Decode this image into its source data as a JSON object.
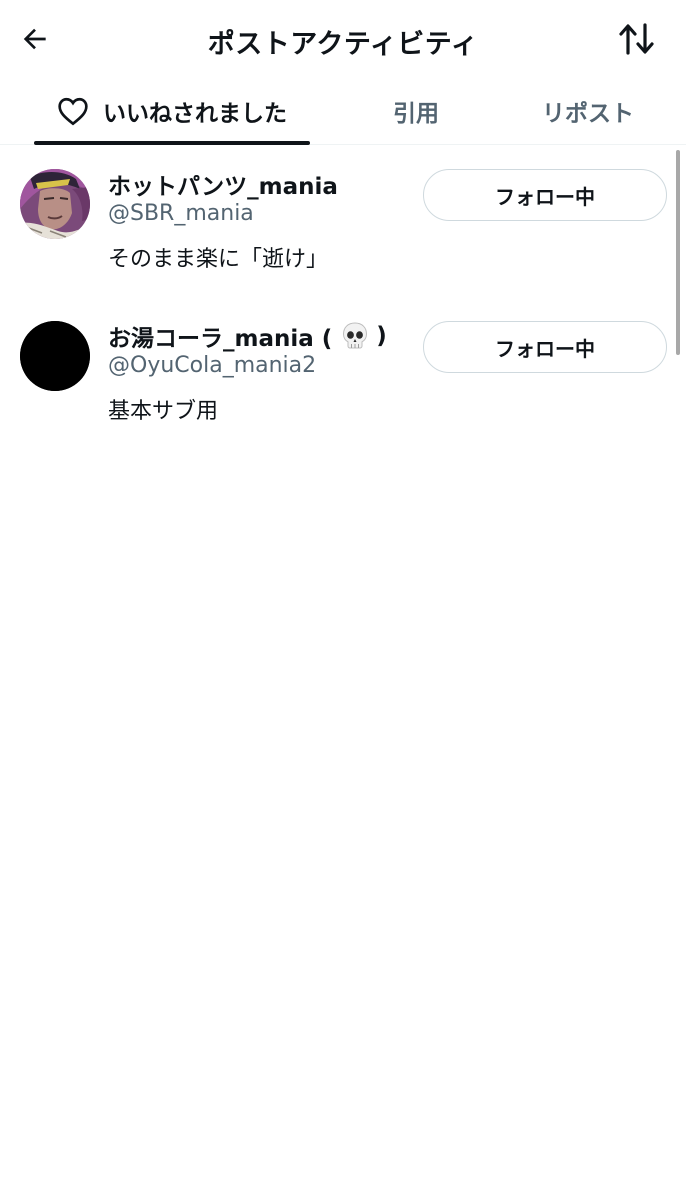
{
  "header": {
    "title": "ポストアクティビティ",
    "back_icon": "arrow-left-icon",
    "sort_icon": "sort-arrows-icon"
  },
  "tabs": [
    {
      "label": "いいねされました",
      "icon": "heart-outline-icon",
      "active": true
    },
    {
      "label": "引用",
      "active": false
    },
    {
      "label": "リポスト",
      "active": false
    }
  ],
  "users": [
    {
      "name": "ホットパンツ_mania",
      "handle": "@SBR_mania",
      "bio": "そのまま楽に「逝け」",
      "follow_label": "フォロー中",
      "avatar": "illustrated-character-avatar"
    },
    {
      "name_prefix": "お湯コーラ_mania (",
      "name_emoji": "skull-icon",
      "name_suffix": ")",
      "handle": "@OyuCola_mania2",
      "bio": "基本サブ用",
      "follow_label": "フォロー中",
      "avatar": "black-circle-avatar"
    }
  ],
  "colors": {
    "text_primary": "#0f1419",
    "text_secondary": "#536471",
    "border": "#cfd9de",
    "divider": "#eff3f4"
  }
}
